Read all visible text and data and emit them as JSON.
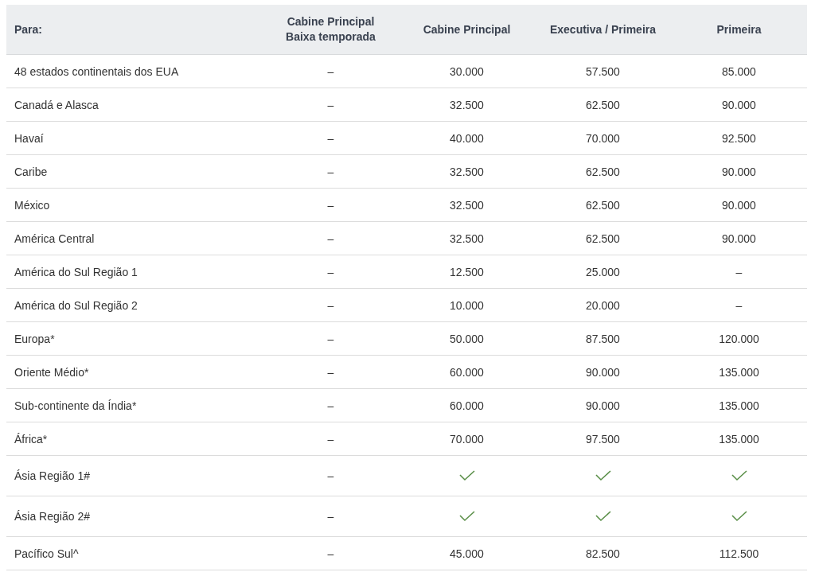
{
  "table": {
    "columns": [
      "Para:",
      "Cabine Principal\nBaixa temporada",
      "Cabine Principal",
      "Executiva / Primeira",
      "Primeira"
    ],
    "rows": [
      {
        "cells": [
          {
            "kind": "text",
            "text": "48 estados continentais dos EUA"
          },
          {
            "kind": "text",
            "text": "–"
          },
          {
            "kind": "text",
            "text": "30.000"
          },
          {
            "kind": "text",
            "text": "57.500"
          },
          {
            "kind": "text",
            "text": "85.000"
          }
        ]
      },
      {
        "cells": [
          {
            "kind": "text",
            "text": "Canadá e Alasca"
          },
          {
            "kind": "text",
            "text": "–"
          },
          {
            "kind": "text",
            "text": "32.500"
          },
          {
            "kind": "text",
            "text": "62.500"
          },
          {
            "kind": "text",
            "text": "90.000"
          }
        ]
      },
      {
        "cells": [
          {
            "kind": "text",
            "text": "Havaí"
          },
          {
            "kind": "text",
            "text": "–"
          },
          {
            "kind": "text",
            "text": "40.000"
          },
          {
            "kind": "text",
            "text": "70.000"
          },
          {
            "kind": "text",
            "text": "92.500"
          }
        ]
      },
      {
        "cells": [
          {
            "kind": "text",
            "text": "Caribe"
          },
          {
            "kind": "text",
            "text": "–"
          },
          {
            "kind": "text",
            "text": "32.500"
          },
          {
            "kind": "text",
            "text": "62.500"
          },
          {
            "kind": "text",
            "text": "90.000"
          }
        ]
      },
      {
        "cells": [
          {
            "kind": "text",
            "text": "México"
          },
          {
            "kind": "text",
            "text": "–"
          },
          {
            "kind": "text",
            "text": "32.500"
          },
          {
            "kind": "text",
            "text": "62.500"
          },
          {
            "kind": "text",
            "text": "90.000"
          }
        ]
      },
      {
        "cells": [
          {
            "kind": "text",
            "text": "América Central"
          },
          {
            "kind": "text",
            "text": "–"
          },
          {
            "kind": "text",
            "text": "32.500"
          },
          {
            "kind": "text",
            "text": "62.500"
          },
          {
            "kind": "text",
            "text": "90.000"
          }
        ]
      },
      {
        "cells": [
          {
            "kind": "text",
            "text": "América do Sul Região 1"
          },
          {
            "kind": "text",
            "text": "–"
          },
          {
            "kind": "text",
            "text": "12.500"
          },
          {
            "kind": "text",
            "text": "25.000"
          },
          {
            "kind": "text",
            "text": "–"
          }
        ]
      },
      {
        "cells": [
          {
            "kind": "text",
            "text": "América do Sul Região 2"
          },
          {
            "kind": "text",
            "text": "–"
          },
          {
            "kind": "text",
            "text": "10.000"
          },
          {
            "kind": "text",
            "text": "20.000"
          },
          {
            "kind": "text",
            "text": "–"
          }
        ]
      },
      {
        "cells": [
          {
            "kind": "text",
            "text": "Europa*"
          },
          {
            "kind": "text",
            "text": "–"
          },
          {
            "kind": "text",
            "text": "50.000"
          },
          {
            "kind": "text",
            "text": "87.500"
          },
          {
            "kind": "text",
            "text": "120.000"
          }
        ]
      },
      {
        "cells": [
          {
            "kind": "text",
            "text": "Oriente Médio*"
          },
          {
            "kind": "text",
            "text": "–"
          },
          {
            "kind": "text",
            "text": "60.000"
          },
          {
            "kind": "text",
            "text": "90.000"
          },
          {
            "kind": "text",
            "text": "135.000"
          }
        ]
      },
      {
        "cells": [
          {
            "kind": "text",
            "text": "Sub-continente da Índia*"
          },
          {
            "kind": "text",
            "text": "–"
          },
          {
            "kind": "text",
            "text": "60.000"
          },
          {
            "kind": "text",
            "text": "90.000"
          },
          {
            "kind": "text",
            "text": "135.000"
          }
        ]
      },
      {
        "cells": [
          {
            "kind": "text",
            "text": "África*"
          },
          {
            "kind": "text",
            "text": "–"
          },
          {
            "kind": "text",
            "text": "70.000"
          },
          {
            "kind": "text",
            "text": "97.500"
          },
          {
            "kind": "text",
            "text": "135.000"
          }
        ]
      },
      {
        "cells": [
          {
            "kind": "text",
            "text": "Ásia Região 1#"
          },
          {
            "kind": "text",
            "text": "–"
          },
          {
            "kind": "check"
          },
          {
            "kind": "check"
          },
          {
            "kind": "check"
          }
        ]
      },
      {
        "cells": [
          {
            "kind": "text",
            "text": "Ásia Região 2#"
          },
          {
            "kind": "text",
            "text": "–"
          },
          {
            "kind": "check"
          },
          {
            "kind": "check"
          },
          {
            "kind": "check"
          }
        ]
      },
      {
        "cells": [
          {
            "kind": "text",
            "text": "Pacífico Sul^"
          },
          {
            "kind": "text",
            "text": "–"
          },
          {
            "kind": "text",
            "text": "45.000"
          },
          {
            "kind": "text",
            "text": "82.500"
          },
          {
            "kind": "text",
            "text": "112.500"
          }
        ]
      }
    ]
  }
}
